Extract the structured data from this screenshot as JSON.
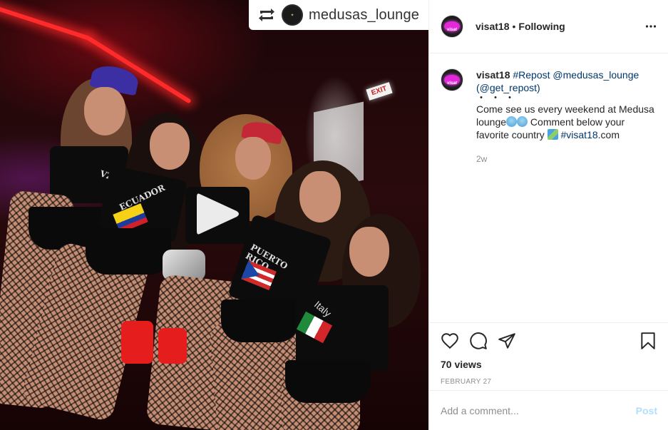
{
  "media": {
    "repost_banner_name": "medusas_lounge",
    "repost_icon": "repost-icon",
    "play_icon": "play-icon",
    "exit_sign_text": "EXIT",
    "shirt_text_1": "ECUADOR",
    "shirt_text_2": "PUERTO RICO",
    "shirt_text_3": "Italy",
    "shirt_text_4": "VZL"
  },
  "header": {
    "username": "visat18",
    "separator": "•",
    "follow_status": "Following",
    "more_icon": "more-horizontal-icon"
  },
  "caption": {
    "username": "visat18",
    "hashtag_repost": "#Repost",
    "mention_author": "@medusas_lounge",
    "get_repost": "(@get_repost)",
    "dots": "・・・",
    "text_1": "Come see us every weekend at Medusa lounge",
    "text_2": " Comment below your favorite country ",
    "hashtag_site": "#visat18",
    "site_suffix": ".com",
    "timestamp": "2w"
  },
  "actions": {
    "like_icon": "heart-icon",
    "comment_icon": "comment-icon",
    "share_icon": "share-icon",
    "save_icon": "bookmark-icon",
    "views": "70 views",
    "date": "FEBRUARY 27"
  },
  "add_comment": {
    "placeholder": "Add a comment...",
    "post_label": "Post"
  },
  "colors": {
    "link": "#00376b",
    "muted": "#8e8e8e",
    "post_disabled": "#b2dffc"
  }
}
